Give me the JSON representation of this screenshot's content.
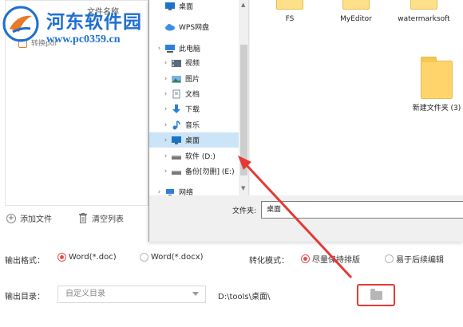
{
  "watermark": {
    "title": "河东软件园",
    "url": "www.pc0359.cn"
  },
  "file_list": {
    "header_label": "文件名称",
    "item_label": "转换pdf"
  },
  "actions": {
    "add_file": "添加文件",
    "clear_list": "清空列表"
  },
  "output_format": {
    "label": "输出格式：",
    "options": [
      "Word(*.doc)",
      "Word(*.docx)"
    ],
    "selected": "Word(*.doc)"
  },
  "convert_mode": {
    "label": "转化模式：",
    "options": [
      "尽量保持排版",
      "易于后续编辑"
    ],
    "selected": "尽量保持排版"
  },
  "output_dir": {
    "label": "输出目录：",
    "select_value": "自定义目录",
    "path": "D:\\tools\\桌面\\"
  },
  "dialog": {
    "nav_items": [
      {
        "label": "桌面",
        "icon": "desktop-icon",
        "expandable": false
      },
      {
        "label": "WPS网盘",
        "icon": "cloud-icon",
        "expandable": false
      },
      {
        "label": "此电脑",
        "icon": "computer-icon",
        "expandable": true
      },
      {
        "label": "视频",
        "icon": "video-icon",
        "expandable": true
      },
      {
        "label": "图片",
        "icon": "picture-icon",
        "expandable": true
      },
      {
        "label": "文档",
        "icon": "document-icon",
        "expandable": true
      },
      {
        "label": "下载",
        "icon": "download-icon",
        "expandable": true
      },
      {
        "label": "音乐",
        "icon": "music-icon",
        "expandable": true
      },
      {
        "label": "桌面",
        "icon": "desktop-icon",
        "expandable": true
      },
      {
        "label": "软件 (D:)",
        "icon": "drive-icon",
        "expandable": true
      },
      {
        "label": "备份[勿删] (E:)",
        "icon": "drive-icon",
        "expandable": true
      },
      {
        "label": "网络",
        "icon": "network-icon",
        "expandable": true
      }
    ],
    "selected_nav": "桌面",
    "folders": [
      {
        "name": "FS"
      },
      {
        "name": "MyEditor"
      },
      {
        "name": "watermarksoft"
      },
      {
        "name": "新建文件夹 (3)"
      }
    ],
    "filename_label": "文件夹:",
    "filename_value": "桌面"
  },
  "colors": {
    "accent_red": "#e53935",
    "selection_blue": "#cce4f7",
    "watermark_blue": "#1e6fd0",
    "folder_yellow": "#ffd56b"
  }
}
